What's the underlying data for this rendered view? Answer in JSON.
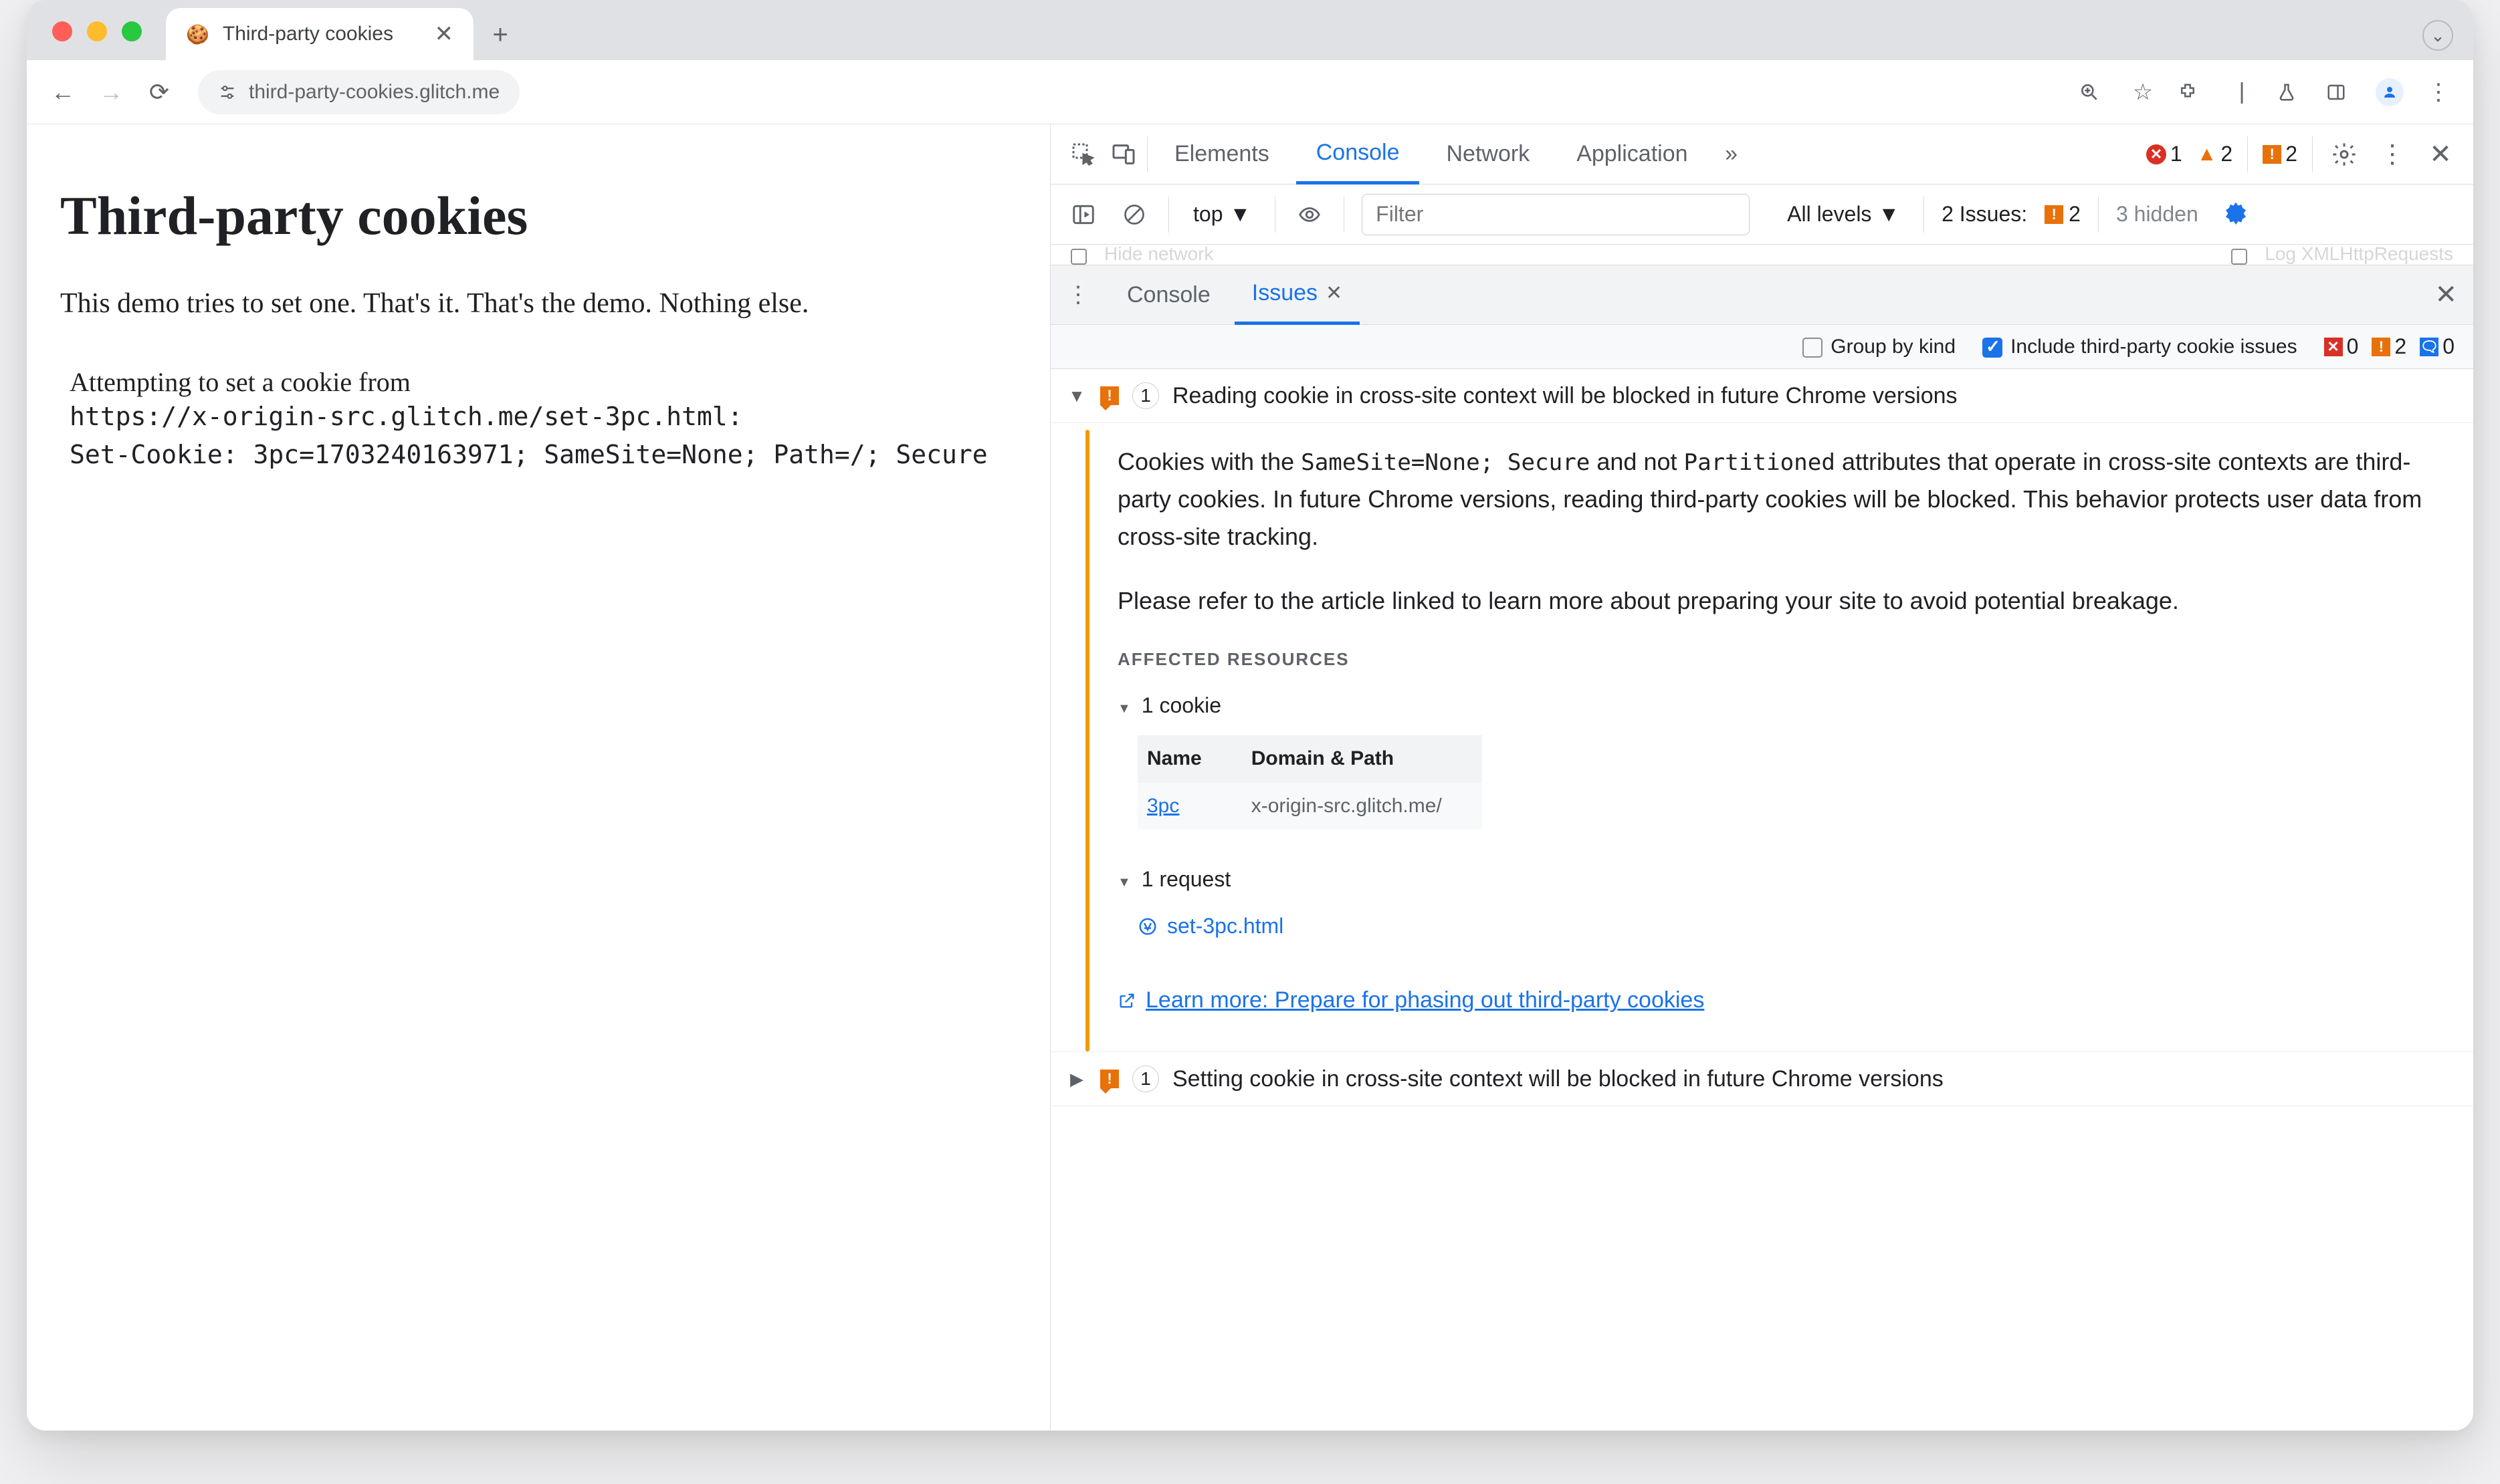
{
  "browser": {
    "tab_title": "Third-party cookies",
    "url": "third-party-cookies.glitch.me"
  },
  "page": {
    "heading": "Third-party cookies",
    "lead": "This demo tries to set one. That's it. That's the demo. Nothing else.",
    "attempt_text": "Attempting to set a cookie from",
    "code_line1": "https://x-origin-src.glitch.me/set-3pc.html:",
    "code_line2": "Set-Cookie: 3pc=1703240163971; SameSite=None; Path=/; Secure"
  },
  "devtools": {
    "tabs": {
      "elements": "Elements",
      "console": "Console",
      "network": "Network",
      "application": "Application"
    },
    "status": {
      "errors": "1",
      "warnings": "2",
      "issues": "2",
      "issues_label": "2 Issues:",
      "issues_count_small": "2",
      "hidden": "3 hidden"
    },
    "toolbar": {
      "context": "top",
      "filter_placeholder": "Filter",
      "levels": "All levels"
    },
    "hidden_row": {
      "left_label": "Hide network",
      "right_label": "Log XMLHttpRequests"
    },
    "drawer": {
      "console": "Console",
      "issues": "Issues"
    },
    "issues_toolbar": {
      "group_by_kind": "Group by kind",
      "include_3pc": "Include third-party cookie issues",
      "counts": {
        "red": "0",
        "orange": "2",
        "blue": "0"
      }
    },
    "issues": [
      {
        "count": "1",
        "title": "Reading cookie in cross-site context will be blocked in future Chrome versions",
        "expanded": true,
        "body_p1_pre": "Cookies with the ",
        "body_p1_code1": "SameSite=None; Secure",
        "body_p1_mid": " and not ",
        "body_p1_code2": "Partitioned",
        "body_p1_post": " attributes that operate in cross-site contexts are third-party cookies. In future Chrome versions, reading third-party cookies will be blocked. This behavior protects user data from cross-site tracking.",
        "body_p2": "Please refer to the article linked to learn more about preparing your site to avoid potential breakage.",
        "affected_heading": "AFFECTED RESOURCES",
        "cookies_summary": "1 cookie",
        "cookie_table": {
          "headers": {
            "name": "Name",
            "domain": "Domain & Path"
          },
          "rows": [
            {
              "name": "3pc",
              "domain": "x-origin-src.glitch.me/"
            }
          ]
        },
        "requests_summary": "1 request",
        "requests": [
          "set-3pc.html"
        ],
        "learn_more": "Learn more: Prepare for phasing out third-party cookies"
      },
      {
        "count": "1",
        "title": "Setting cookie in cross-site context will be blocked in future Chrome versions",
        "expanded": false
      }
    ]
  }
}
